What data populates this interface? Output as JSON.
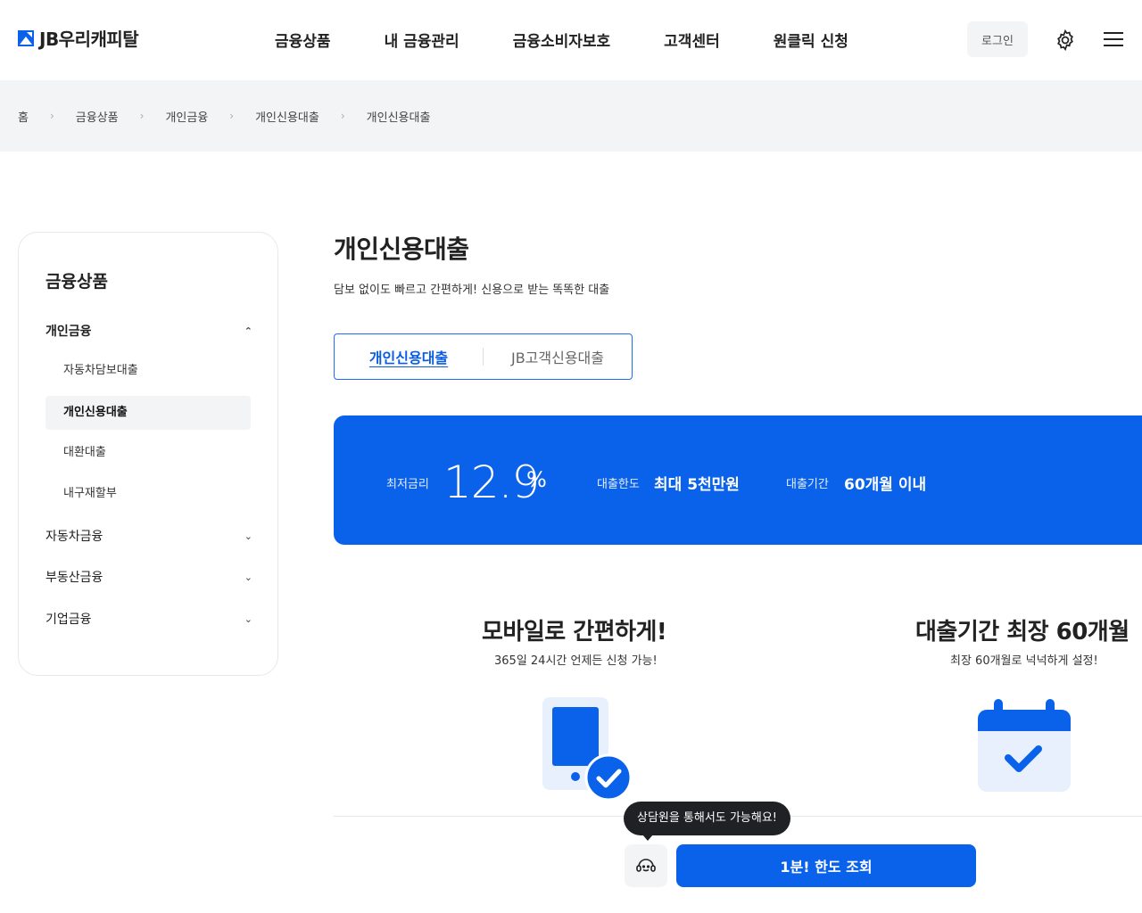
{
  "header": {
    "logo_text": "JB우리캐피탈",
    "nav": [
      "금융상품",
      "내 금융관리",
      "금융소비자보호",
      "고객센터",
      "원클릭 신청"
    ],
    "login_label": "로그인",
    "brand_color": "#0a62ea"
  },
  "breadcrumb": [
    "홈",
    "금융상품",
    "개인금융",
    "개인신용대출",
    "개인신용대출"
  ],
  "sidebar": {
    "title": "금융상품",
    "groups": [
      {
        "label": "개인금융",
        "expanded": true,
        "chevron": "chevron-up-icon"
      },
      {
        "label": "자동차금융",
        "chevron": "chevron-down-icon"
      },
      {
        "label": "부동산금융",
        "chevron": "chevron-down-icon"
      },
      {
        "label": "기업금융",
        "chevron": "chevron-down-icon"
      }
    ],
    "subitems": [
      "자동차담보대출",
      "개인신용대출",
      "대환대출",
      "내구재할부"
    ],
    "selected_subitem": "개인신용대출"
  },
  "main": {
    "title": "개인신용대출",
    "description": "담보 없이도 빠르고 간편하게! 신용으로 받는 똑똑한 대출",
    "tabs": [
      {
        "label": "개인신용대출",
        "active": true
      },
      {
        "label": "JB고객신용대출",
        "active": false
      }
    ],
    "banner": {
      "rate_label": "최저금리",
      "rate_value": "12.9",
      "rate_unit": "%",
      "limit_label": "대출한도",
      "limit_value": "최대 5천만원",
      "period_label": "대출기간",
      "period_value": "60개월 이내"
    },
    "features": [
      {
        "title": "모바일로 간편하게!",
        "desc": "365일 24시간 언제든 신청 가능!",
        "icon": "phone-check-icon"
      },
      {
        "title": "대출기간 최장 60개월",
        "desc": "최장 60개월로 넉넉하게 설정!",
        "icon": "calendar-check-icon"
      }
    ]
  },
  "footer_cta": {
    "tooltip": "상담원을 통해서도 가능해요!",
    "button_label": "1분! 한도 조회"
  }
}
